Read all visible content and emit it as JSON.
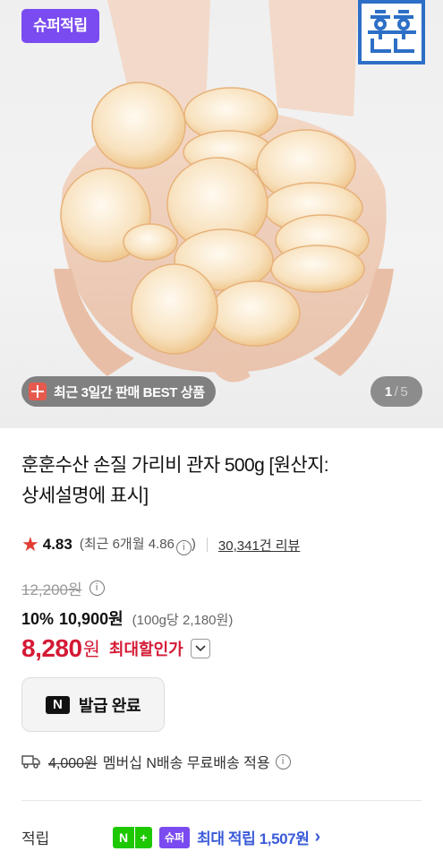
{
  "hero": {
    "super_badge": "슈퍼적립",
    "brand_logo_text": "훈훈",
    "best_label": "최근 3일간 판매 BEST 상품",
    "image_index": "1",
    "image_total": "5"
  },
  "product": {
    "title_line1": "훈훈수산 손질 가리비 관자 500g [원산지:",
    "title_line2": "상세설명에 표시]",
    "rating": "4.83",
    "recent_rating_text": "(최근 6개월 4.86",
    "recent_rating_close": ")",
    "review_count": "30,341건 리뷰",
    "original_price": "12,200원",
    "discount": "10%",
    "sale_price": "10,900원",
    "unit_price": "(100g당 2,180원)",
    "max_price": "8,280",
    "max_won": "원",
    "max_label": "최대할인가"
  },
  "coupon": {
    "icon": "N",
    "label": "발급 완료"
  },
  "shipping": {
    "original_fee": "4,000원",
    "text": "멤버십 N배송 무료배송 적용"
  },
  "reward": {
    "label": "적립",
    "badge_n": "N",
    "badge_plus": "+",
    "badge_super": "슈퍼",
    "text": "최대 적립 1,507원"
  },
  "colors": {
    "accent_red": "#d41a35",
    "super_purple": "#7a4bf0",
    "naver_green": "#1ec800",
    "link_blue": "#3a5bd9"
  }
}
